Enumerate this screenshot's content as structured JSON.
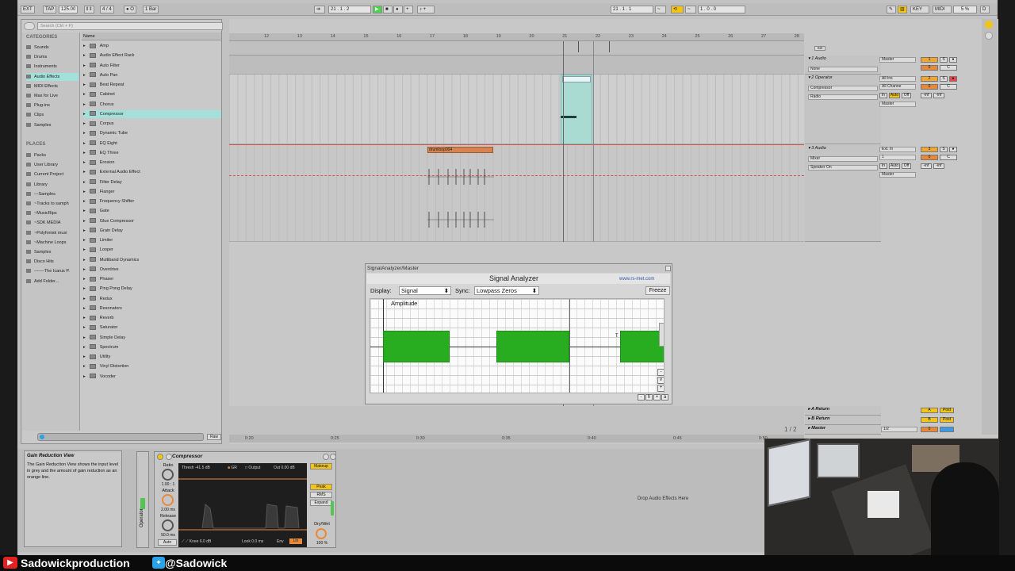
{
  "transport": {
    "ext": "EXT",
    "tap": "TAP",
    "tempo": "125.00",
    "sig": "4 / 4",
    "quant": "1 Bar",
    "pos": "21 .  1 .  2",
    "loop_start": "21 .  1 .  1",
    "loop_len": "1 .  0 .  0",
    "key": "KEY",
    "midi": "MIDI",
    "cpu": "5 %",
    "d": "D"
  },
  "browser": {
    "search_placeholder": "Search (Ctrl + F)",
    "categories_title": "CATEGORIES",
    "categories": [
      "Sounds",
      "Drums",
      "Instruments",
      "Audio Effects",
      "MIDI Effects",
      "Max for Live",
      "Plug-ins",
      "Clips",
      "Samples"
    ],
    "places_title": "PLACES",
    "places": [
      "Packs",
      "User Library",
      "Current Project",
      "Library",
      "---Samples",
      "~Tracks to samph",
      "~MusicRips",
      "~SDK MEDIA",
      "~Polyfonisk musi",
      "~Machine Loops",
      "Samples",
      "Disco Hits",
      "-------The Icarus P.",
      "Add Folder..."
    ],
    "name_header": "Name",
    "items": [
      "Amp",
      "Audio Effect Rack",
      "Auto Filter",
      "Auto Pan",
      "Beat Repeat",
      "Cabinet",
      "Chorus",
      "Compressor",
      "Corpus",
      "Dynamic Tube",
      "EQ Eight",
      "EQ Three",
      "Erosion",
      "External Audio Effect",
      "Filter Delay",
      "Flanger",
      "Frequency Shifter",
      "Gate",
      "Glue Compressor",
      "Grain Delay",
      "Limiter",
      "Looper",
      "Multiband Dynamics",
      "Overdrive",
      "Phaser",
      "Ping Pong Delay",
      "Redux",
      "Resonators",
      "Reverb",
      "Saturator",
      "Simple Delay",
      "Spectrum",
      "Utility",
      "Vinyl Distortion",
      "Vocoder"
    ],
    "raw": "Raw"
  },
  "arrangement": {
    "ruler": [
      "12",
      "13",
      "14",
      "15",
      "16",
      "17",
      "18",
      "19",
      "20",
      "21",
      "22",
      "23",
      "24",
      "25",
      "26",
      "27",
      "28"
    ],
    "time_ruler": [
      "0:20",
      "0:25",
      "0:30",
      "0:35",
      "0:40",
      "0:45",
      "0:50"
    ],
    "page": "1 / 2",
    "clip_name": "drumloop004",
    "set": "Set"
  },
  "tracks": [
    {
      "name": "1 Audio",
      "in": "None",
      "out": "Master",
      "num": "1"
    },
    {
      "name": "2 Operator",
      "in": "Compressor",
      "in2": "Radio",
      "ch": "All Ins",
      "ch2": "All Channe",
      "out": "Master",
      "num": "2",
      "in_b": "In",
      "auto": "Auto",
      "off": "Off",
      "inf1": "-inf",
      "inf2": "-inf"
    },
    {
      "name": "3 Audio",
      "in": "Mixer",
      "in2": "Speaker On",
      "ch": "Ext. In",
      "ch2": "1",
      "out": "Master",
      "num": "3",
      "in_b": "In",
      "auto": "Auto",
      "off": "Off",
      "inf1": "-inf",
      "inf2": "-inf"
    }
  ],
  "returns": [
    {
      "name": "A Return",
      "num": "A",
      "post": "Post"
    },
    {
      "name": "B Return",
      "num": "B",
      "post": "Post"
    },
    {
      "name": "Master",
      "num": "0",
      "ch": "1/2"
    }
  ],
  "mixer_labels": {
    "s": "S",
    "c": "C",
    "zero": "0"
  },
  "analyzer": {
    "window_title": "SignalAnalyzer/Master",
    "title": "Signal Analyzer",
    "url": "www.rs-met.com",
    "display_label": "Display:",
    "display_value": "Signal",
    "sync_label": "Sync:",
    "sync_value": "Lowpass Zeros",
    "freeze": "Freeze",
    "y_label": "Amplitude",
    "t_label": "T",
    "zoom": [
      "-",
      "h",
      "+",
      "a"
    ],
    "vzoom": [
      "-",
      "v",
      "+"
    ]
  },
  "info": {
    "title": "Gain Reduction View",
    "text": "The Gain Reduction View shows the input level in grey and the amount of gain reduction as an orange line."
  },
  "compressor": {
    "title": "Compressor",
    "track": "Operator",
    "thresh": "Thresh -41.5 dB",
    "gr": "GR",
    "output": "Output",
    "out": "Out 0.00 dB",
    "makeup": "Makeup",
    "ratio_label": "Ratio",
    "ratio": "1.00 : 1",
    "attack_label": "Attack",
    "attack": "2.00 ms",
    "release_label": "Release",
    "release": "50.0 ms",
    "auto": "Auto",
    "peak": "Peak",
    "rms": "RMS",
    "expand": "Expand",
    "drywet_label": "Dry/Wet",
    "drywet": "100 %",
    "knee": "Knee 6.0 dB",
    "look": "Look 0.0 ms",
    "env": "Env",
    "lin": "Lin"
  },
  "drop_text": "Drop Audio Effects Here",
  "footer": {
    "youtube": "Sadowickproduction",
    "twitter": "@Sadowick"
  }
}
